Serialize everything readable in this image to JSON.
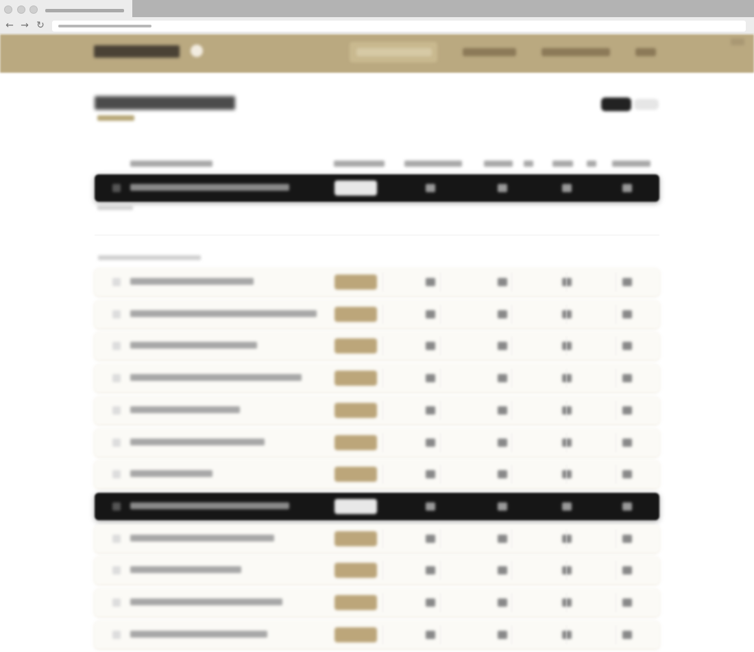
{
  "window": {
    "tab_title": "",
    "url": ""
  },
  "site": {
    "logo": "",
    "nav": [
      "",
      "",
      "",
      ""
    ]
  },
  "page": {
    "title": "",
    "subtitle": "",
    "toggle": [
      "",
      ""
    ]
  },
  "table": {
    "columns": [
      "",
      "",
      "",
      "",
      "",
      "",
      "",
      ""
    ],
    "pinned_row": {
      "rank": "",
      "name": "",
      "badge": "",
      "cols": [
        "",
        "",
        "",
        ""
      ]
    },
    "group_label": "",
    "rows": [
      {
        "rank": "",
        "name": "",
        "dark": false
      },
      {
        "rank": "",
        "name": "",
        "dark": false
      },
      {
        "rank": "",
        "name": "",
        "dark": false
      },
      {
        "rank": "",
        "name": "",
        "dark": false
      },
      {
        "rank": "",
        "name": "",
        "dark": false
      },
      {
        "rank": "",
        "name": "",
        "dark": false
      },
      {
        "rank": "",
        "name": "",
        "dark": false
      },
      {
        "rank": "",
        "name": "",
        "dark": true
      },
      {
        "rank": "",
        "name": "",
        "dark": false
      },
      {
        "rank": "",
        "name": "",
        "dark": false
      },
      {
        "rank": "",
        "name": "",
        "dark": false
      },
      {
        "rank": "",
        "name": "",
        "dark": false
      }
    ]
  },
  "colors": {
    "header_bg": "#baa980",
    "accent_badge": "#bca67a",
    "dark_row": "#161616"
  }
}
